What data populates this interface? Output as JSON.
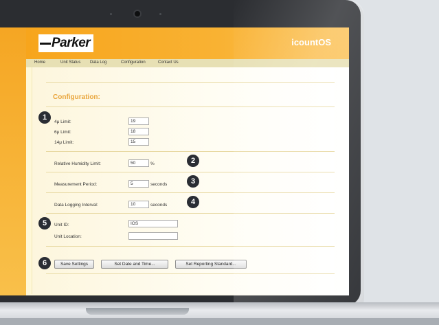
{
  "brand": {
    "logo_text": "Parker",
    "app_name": "icountOS"
  },
  "nav": [
    "Home",
    "Unit Status",
    "Data Log",
    "Configuration",
    "Contact Us"
  ],
  "page_title": "Configuration:",
  "limits": [
    {
      "label": "4μ Limit:",
      "value": "19"
    },
    {
      "label": "6μ Limit:",
      "value": "18"
    },
    {
      "label": "14μ Limit:",
      "value": "15"
    }
  ],
  "humidity": {
    "label": "Relative Humidity Limit:",
    "value": "50",
    "unit": "%"
  },
  "measurement": {
    "label": "Measurement Period:",
    "value": "5",
    "unit": "seconds"
  },
  "logging": {
    "label": "Data Logging Interval:",
    "value": "10",
    "unit": "seconds"
  },
  "unit_id": {
    "label": "Unit ID:",
    "value": "IOS"
  },
  "unit_location": {
    "label": "Unit Location:",
    "value": ""
  },
  "buttons": {
    "save": "Save Settings",
    "datetime": "Set Date and Time...",
    "reporting": "Set Reporting Standard..."
  },
  "badges": [
    "1",
    "2",
    "3",
    "4",
    "5",
    "6"
  ]
}
